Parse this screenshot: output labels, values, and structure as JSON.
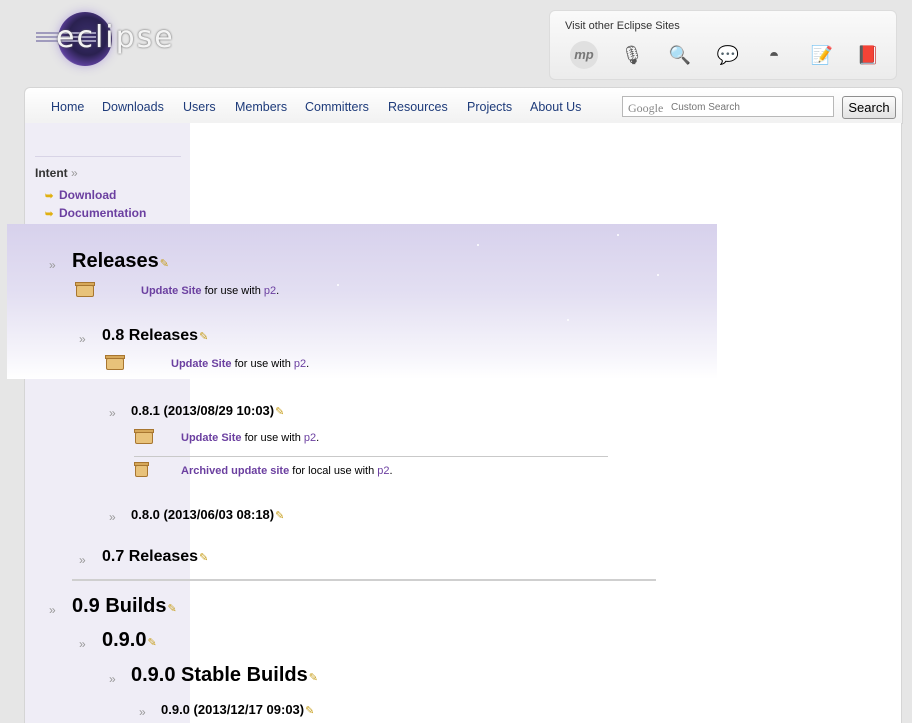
{
  "logo": {
    "word": "eclipse"
  },
  "sites": {
    "title": "Visit other Eclipse Sites",
    "icons": [
      "mp-icon",
      "microphone-icon",
      "magnifier-icon",
      "chat-bubbles-icon",
      "bowl-icon",
      "notepad-icon",
      "book-icon"
    ],
    "mp_label": "mp"
  },
  "nav": {
    "items": [
      "Home",
      "Downloads",
      "Users",
      "Members",
      "Committers",
      "Resources",
      "Projects",
      "About Us"
    ],
    "search_placeholder": "Custom Search",
    "google_label": "Google",
    "search_button": "Search"
  },
  "sidebar": {
    "heading": "Intent",
    "heading_arrows": "»",
    "links": [
      "Download",
      "Documentation"
    ]
  },
  "tree": {
    "raquo": "»",
    "pencil": "✎",
    "releases": {
      "title": "Releases",
      "update_site": "Update Site",
      "for_use": " for use with ",
      "p2": "p2",
      "period": "."
    },
    "r08": {
      "title": "0.8 Releases"
    },
    "r081": {
      "title": "0.8.1 (2013/08/29 10:03)",
      "archived": "Archived update site",
      "for_local": " for local use with "
    },
    "r080": {
      "title": "0.8.0 (2013/06/03 08:18)"
    },
    "r07": {
      "title": "0.7 Releases"
    },
    "b09": {
      "title": "0.9 Builds"
    },
    "b090": {
      "title": "0.9.0"
    },
    "b090stable": {
      "title": "0.9.0 Stable Builds"
    },
    "b090cut": {
      "title": "0.9.0 (2013/12/17 09:03)"
    }
  },
  "colors": {
    "link": "#6b3fa0",
    "nav": "#1e3b7a",
    "sidebar_bg": "#efedf6"
  }
}
